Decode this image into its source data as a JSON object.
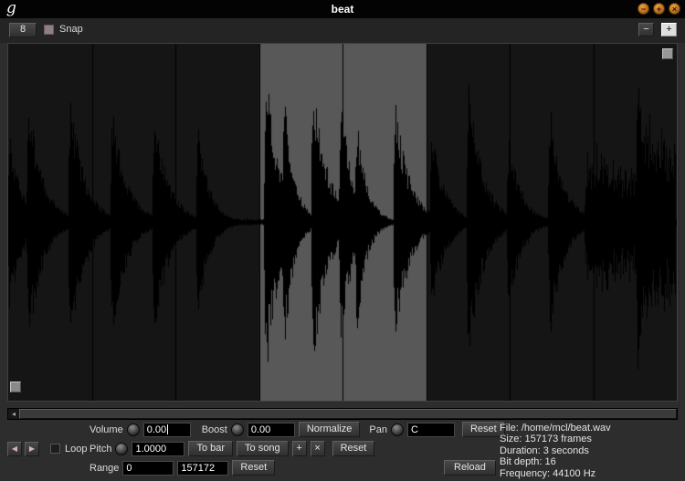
{
  "window": {
    "title": "beat",
    "logo": "g"
  },
  "titlebar": {
    "minimize": "−",
    "maximize": "+",
    "close": "×"
  },
  "toolbar": {
    "snap_value": "8",
    "snap_label": "Snap",
    "zoom_out": "−",
    "zoom_in": "+"
  },
  "waveform": {
    "bars": 8,
    "selection": {
      "start_frac": 0.375,
      "end_frac": 0.625
    },
    "colors": {
      "bg": "#151515",
      "wave": "#000000",
      "selection": "#585858",
      "gridline": "#000000"
    },
    "hits": [
      [
        0.001,
        0.55,
        14
      ],
      [
        0.03,
        0.75,
        16
      ],
      [
        0.092,
        0.78,
        16
      ],
      [
        0.155,
        0.72,
        16
      ],
      [
        0.218,
        0.7,
        16
      ],
      [
        0.283,
        0.58,
        13
      ],
      [
        0.385,
        0.95,
        15
      ],
      [
        0.412,
        0.8,
        11
      ],
      [
        0.455,
        0.9,
        16
      ],
      [
        0.497,
        0.78,
        13
      ],
      [
        0.521,
        0.66,
        11
      ],
      [
        0.578,
        0.74,
        16
      ],
      [
        0.633,
        0.58,
        14
      ],
      [
        0.688,
        0.84,
        16
      ],
      [
        0.748,
        0.56,
        14
      ],
      [
        0.81,
        0.7,
        15
      ],
      [
        0.941,
        0.92,
        10
      ]
    ],
    "noise_bursts": [
      [
        0.86,
        0.078,
        0.52
      ],
      [
        0.938,
        0.06,
        0.8
      ]
    ]
  },
  "scrollbar": {
    "left_arrow": "◂"
  },
  "transport": {
    "prev": "◀",
    "play": "▶"
  },
  "controls": {
    "volume": {
      "label": "Volume",
      "value": "0.00"
    },
    "boost": {
      "label": "Boost",
      "value": "0.00"
    },
    "normalize_label": "Normalize",
    "pan": {
      "label": "Pan",
      "value": "C"
    },
    "reset_label": "Reset",
    "loop_label": "Loop",
    "pitch": {
      "label": "Pitch",
      "value": "1.0000"
    },
    "to_bar_label": "To bar",
    "to_song_label": "To song",
    "add_label": "+",
    "remove_label": "×",
    "range": {
      "label": "Range",
      "start": "0",
      "end": "157172"
    },
    "reload_label": "Reload"
  },
  "info": {
    "file": "File: /home/mcl/beat.wav",
    "size": "Size: 157173 frames",
    "duration": "Duration: 3 seconds",
    "bit_depth": "Bit depth: 16",
    "frequency": "Frequency: 44100 Hz"
  }
}
